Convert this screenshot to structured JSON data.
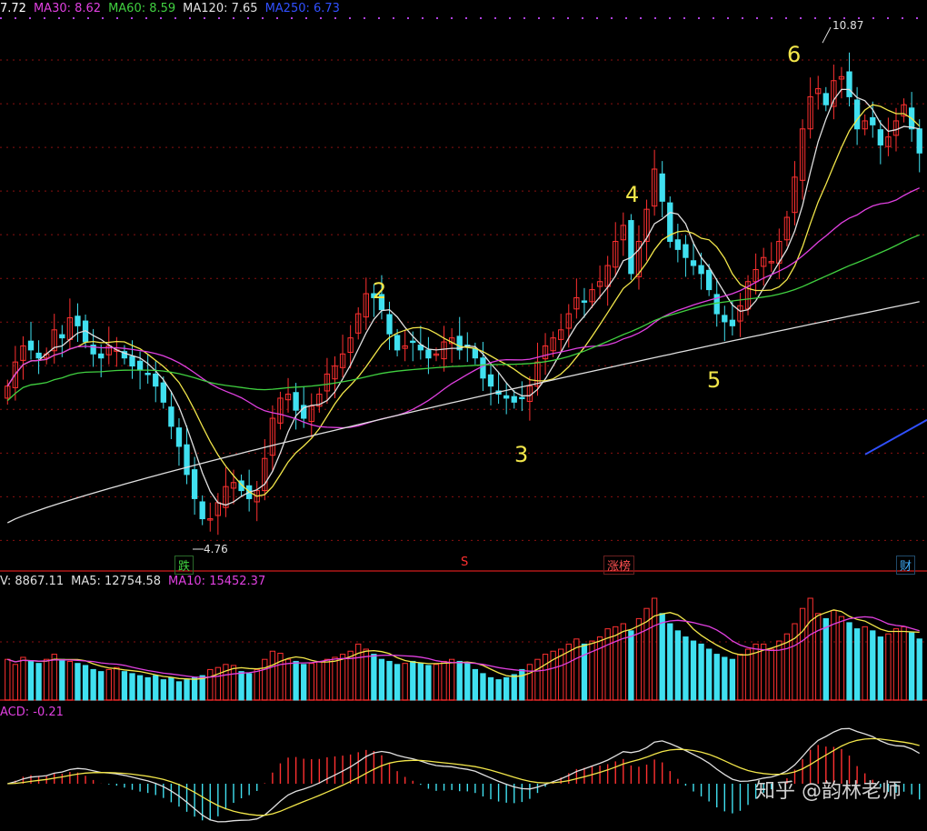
{
  "header_price": {
    "items": [
      {
        "label": "7.72",
        "color": "#ffffff"
      },
      {
        "label": "MA30: 8.62",
        "color": "#e040e0"
      },
      {
        "label": "MA60: 8.59",
        "color": "#40d040"
      },
      {
        "label": "MA120: 7.65",
        "color": "#e0e0e0"
      },
      {
        "label": "MA250: 6.73",
        "color": "#3050ff"
      }
    ]
  },
  "header_volume": {
    "items": [
      {
        "label": "V: 8867.11",
        "color": "#e0e0e0"
      },
      {
        "label": "MA5: 12754.58",
        "color": "#e0e0e0"
      },
      {
        "label": "MA10: 15452.37",
        "color": "#e040e0"
      }
    ]
  },
  "header_macd": {
    "items": [
      {
        "label": "ACD: -0.21",
        "color": "#e040e0"
      }
    ]
  },
  "annotations": {
    "high_price": "10.87",
    "low_price": "4.76",
    "point_2": "2",
    "point_3": "3",
    "point_4": "4",
    "point_5": "5",
    "point_6": "6"
  },
  "tags": {
    "tag_die": "跌",
    "tag_s": "S",
    "tag_zhangbang": "涨榜",
    "tag_cai": "财"
  },
  "watermark": "知乎 @韵林老师",
  "colors": {
    "up": "#ff3030",
    "down": "#40e0f0",
    "grid": "#8a1010",
    "separator": "#b01818",
    "ma_fast": "#e0e0e0",
    "ma_mid": "#f2e64a",
    "ma30": "#e040e0",
    "ma60": "#40d040",
    "ma120": "#e0e0e0",
    "ma250": "#3050ff",
    "label": "#f2e64a"
  },
  "chart_data": {
    "type": "candlestick",
    "price_range": [
      4.3,
      11.2
    ],
    "closes": [
      6.6,
      6.9,
      7.1,
      7.05,
      6.95,
      7.0,
      7.3,
      7.2,
      7.45,
      7.35,
      7.15,
      7.0,
      6.95,
      7.1,
      7.05,
      6.95,
      6.85,
      6.8,
      6.75,
      6.6,
      6.4,
      6.1,
      5.85,
      5.5,
      5.2,
      4.95,
      4.95,
      5.15,
      5.35,
      5.4,
      5.3,
      5.2,
      5.3,
      5.7,
      6.2,
      6.45,
      6.5,
      6.3,
      6.2,
      6.35,
      6.5,
      6.75,
      6.85,
      7.0,
      7.2,
      7.5,
      7.75,
      7.7,
      7.55,
      7.25,
      7.05,
      7.1,
      7.15,
      7.05,
      6.95,
      7.0,
      7.15,
      7.2,
      7.05,
      7.1,
      6.95,
      6.7,
      6.6,
      6.5,
      6.45,
      6.4,
      6.45,
      6.6,
      6.9,
      7.1,
      7.2,
      7.3,
      7.5,
      7.7,
      7.65,
      7.8,
      7.9,
      8.1,
      8.4,
      8.6,
      8.0,
      8.4,
      8.8,
      9.3,
      8.9,
      8.4,
      8.3,
      8.2,
      8.1,
      8.0,
      7.8,
      7.5,
      7.4,
      7.35,
      7.6,
      7.9,
      8.05,
      8.2,
      8.15,
      8.4,
      8.7,
      9.2,
      9.8,
      10.2,
      10.3,
      10.1,
      10.4,
      10.45,
      10.2,
      9.8,
      9.9,
      9.85,
      9.6,
      9.7,
      9.9,
      10.1,
      9.8,
      9.5
    ],
    "volumes": [
      0.4,
      0.35,
      0.42,
      0.38,
      0.36,
      0.4,
      0.45,
      0.4,
      0.38,
      0.36,
      0.34,
      0.3,
      0.28,
      0.3,
      0.32,
      0.28,
      0.26,
      0.24,
      0.22,
      0.24,
      0.2,
      0.22,
      0.18,
      0.2,
      0.22,
      0.24,
      0.3,
      0.32,
      0.35,
      0.34,
      0.28,
      0.26,
      0.3,
      0.4,
      0.48,
      0.46,
      0.4,
      0.38,
      0.35,
      0.36,
      0.38,
      0.4,
      0.42,
      0.45,
      0.48,
      0.55,
      0.5,
      0.45,
      0.4,
      0.38,
      0.35,
      0.36,
      0.38,
      0.36,
      0.34,
      0.35,
      0.38,
      0.4,
      0.38,
      0.36,
      0.3,
      0.26,
      0.22,
      0.2,
      0.22,
      0.25,
      0.3,
      0.35,
      0.4,
      0.45,
      0.48,
      0.5,
      0.55,
      0.6,
      0.55,
      0.58,
      0.62,
      0.7,
      0.72,
      0.75,
      0.68,
      0.8,
      0.9,
      1.0,
      0.85,
      0.75,
      0.68,
      0.62,
      0.58,
      0.55,
      0.5,
      0.45,
      0.42,
      0.4,
      0.45,
      0.5,
      0.55,
      0.55,
      0.5,
      0.58,
      0.65,
      0.75,
      0.9,
      1.0,
      0.85,
      0.8,
      0.88,
      0.82,
      0.76,
      0.7,
      0.72,
      0.68,
      0.62,
      0.65,
      0.7,
      0.72,
      0.66,
      0.6
    ],
    "ma120_range": [
      4.9,
      7.65
    ],
    "ma250_end": 6.73,
    "price_labels": {
      "high": 10.87,
      "low": 4.76
    }
  }
}
